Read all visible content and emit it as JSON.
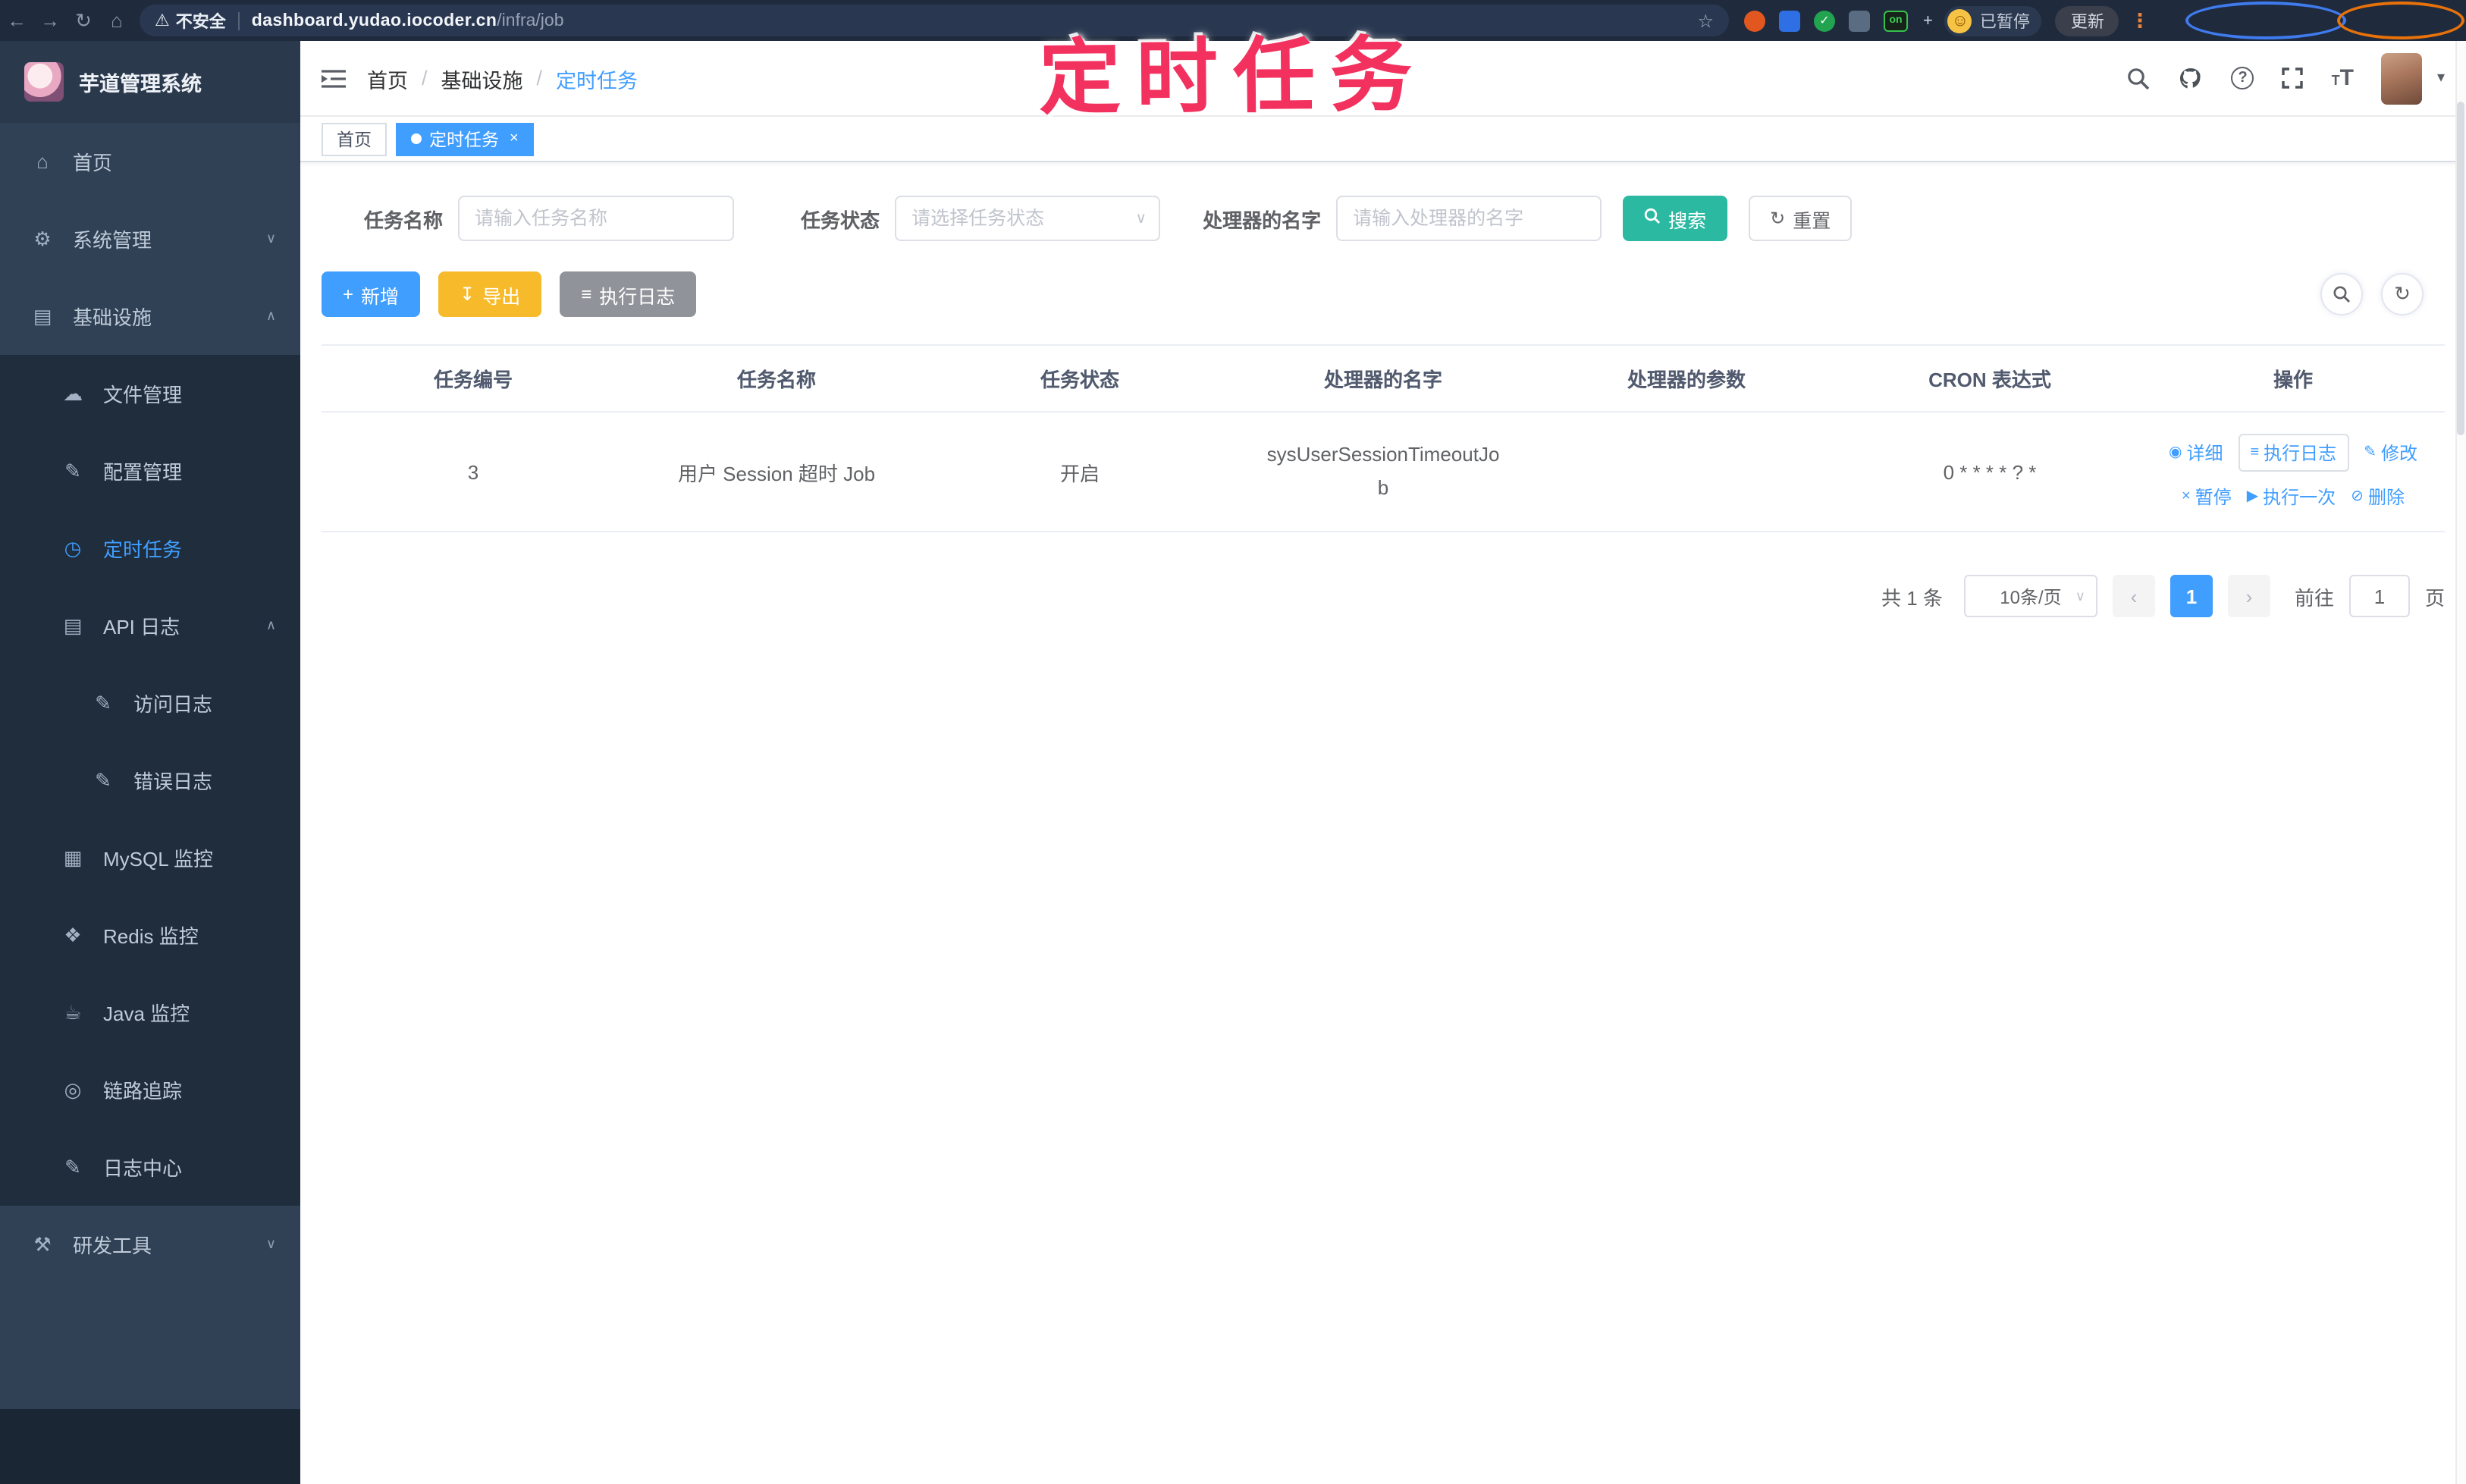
{
  "annotation": {
    "title": "定时任务"
  },
  "browser": {
    "warning_label": "不安全",
    "url_host": "dashboard.yudao.iocoder.cn",
    "url_path": "/infra/job",
    "on_badge": "on",
    "paused_label": "已暂停",
    "update_label": "更新"
  },
  "sidebar": {
    "title": "芋道管理系统",
    "items": [
      {
        "label": "首页",
        "glyph": "⌂",
        "chevron": ""
      },
      {
        "label": "系统管理",
        "glyph": "⚙",
        "chevron": "∨"
      },
      {
        "label": "基础设施",
        "glyph": "▤",
        "chevron": "∧"
      },
      {
        "label": "文件管理",
        "glyph": "☁",
        "chevron": ""
      },
      {
        "label": "配置管理",
        "glyph": "✎",
        "chevron": ""
      },
      {
        "label": "定时任务",
        "glyph": "◷",
        "chevron": ""
      },
      {
        "label": "API 日志",
        "glyph": "▤",
        "chevron": "∧"
      },
      {
        "label": "访问日志",
        "glyph": "✎",
        "chevron": ""
      },
      {
        "label": "错误日志",
        "glyph": "✎",
        "chevron": ""
      },
      {
        "label": "MySQL 监控",
        "glyph": "▦",
        "chevron": ""
      },
      {
        "label": "Redis 监控",
        "glyph": "❖",
        "chevron": ""
      },
      {
        "label": "Java 监控",
        "glyph": "☕",
        "chevron": ""
      },
      {
        "label": "链路追踪",
        "glyph": "◎",
        "chevron": ""
      },
      {
        "label": "日志中心",
        "glyph": "✎",
        "chevron": ""
      },
      {
        "label": "研发工具",
        "glyph": "⚒",
        "chevron": "∨"
      }
    ]
  },
  "header": {
    "breadcrumb": [
      "首页",
      "基础设施",
      "定时任务"
    ],
    "separator": "/"
  },
  "tags": {
    "home": "首页",
    "current": "定时任务",
    "close_glyph": "×"
  },
  "filters": {
    "name_label": "任务名称",
    "name_placeholder": "请输入任务名称",
    "status_label": "任务状态",
    "status_placeholder": "请选择任务状态",
    "handler_label": "处理器的名字",
    "handler_placeholder": "请输入处理器的名字",
    "search_label": "搜索",
    "reset_label": "重置"
  },
  "toolbar": {
    "add_label": "新增",
    "export_label": "导出",
    "joblog_label": "执行日志"
  },
  "table": {
    "columns": [
      "任务编号",
      "任务名称",
      "任务状态",
      "处理器的名字",
      "处理器的参数",
      "CRON 表达式",
      "操作"
    ],
    "rows": [
      {
        "id": "3",
        "name": "用户 Session 超时 Job",
        "status": "开启",
        "handler": "sysUserSessionTimeoutJob",
        "param": "",
        "cron": "0 * * * * ? *"
      }
    ],
    "row_actions": {
      "detail": {
        "label": "详细",
        "glyph": "◉"
      },
      "exec_log": {
        "label": "执行日志",
        "glyph": "≡"
      },
      "edit": {
        "label": "修改",
        "glyph": "✎"
      },
      "pause": {
        "label": "暂停",
        "glyph": "×"
      },
      "run_once": {
        "label": "执行一次",
        "glyph": "▶"
      },
      "delete": {
        "label": "删除",
        "glyph": "⊘"
      }
    }
  },
  "pagination": {
    "total": "共 1 条",
    "page_size": "10条/页",
    "current": "1",
    "goto_label": "前往",
    "goto_value": "1",
    "page_label": "页"
  },
  "colors": {
    "accent_blue": "#409eff",
    "search_teal": "#2cb9a2",
    "export_yellow": "#f7ba2a",
    "info_gray": "#909399",
    "sidebar_bg": "#304156",
    "submenu_bg": "#1f2d3d",
    "annotation_pink": "#f3315e"
  }
}
